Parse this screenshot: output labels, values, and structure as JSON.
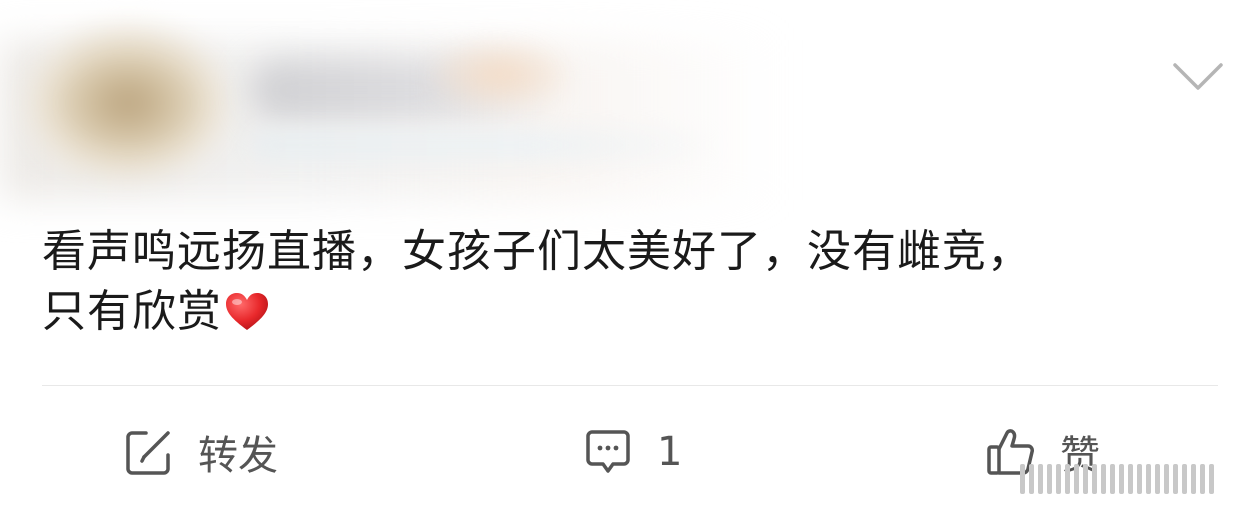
{
  "post": {
    "content_line1": "看声鸣远扬直播，女孩子们太美好了，没有雌竞，",
    "content_line2": "只有欣赏",
    "content_emoji": "heart-emoji"
  },
  "actions": {
    "repost_label": "转发",
    "comment_count": "1",
    "like_label": "赞"
  },
  "colors": {
    "text": "#1a1a1a",
    "action_text": "#555555",
    "heart": "#e8282b",
    "divider": "#e8e8e8"
  }
}
